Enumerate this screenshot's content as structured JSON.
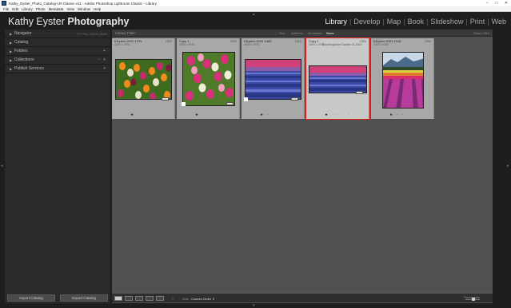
{
  "window": {
    "title": "Kathy_Eyster_Photo_Catalog-LR-Classic-v11 - Adobe Photoshop Lightroom Classic - Library",
    "minimize": "–",
    "maximize": "□",
    "close": "✕"
  },
  "menu": [
    "File",
    "Edit",
    "Library",
    "Photo",
    "Metadata",
    "View",
    "Window",
    "Help"
  ],
  "identity_plate": {
    "name": "Kathy Eyster",
    "studio": "Photography"
  },
  "modules": [
    {
      "label": "Library",
      "active": true
    },
    {
      "label": "Develop",
      "active": false
    },
    {
      "label": "Map",
      "active": false
    },
    {
      "label": "Book",
      "active": false
    },
    {
      "label": "Slideshow",
      "active": false
    },
    {
      "label": "Print",
      "active": false
    },
    {
      "label": "Web",
      "active": false
    }
  ],
  "left_panel": {
    "navigator": {
      "label": "Navigator",
      "extras": "FIT  FILL  100%  200%"
    },
    "catalog": {
      "label": "Catalog"
    },
    "folders": {
      "label": "Folders",
      "plus": "+"
    },
    "collections": {
      "label": "Collections",
      "minus": "−",
      "plus": "+"
    },
    "publish": {
      "label": "Publish Services",
      "plus": "+"
    },
    "import_button": "Import Catalog",
    "export_button": "Export Catalog"
  },
  "filter_bar": {
    "title": "Library Filter :",
    "options": [
      {
        "label": "Text",
        "active": false
      },
      {
        "label": "Attribute",
        "active": false
      },
      {
        "label": "Metadata",
        "active": false
      },
      {
        "label": "None",
        "active": true
      }
    ],
    "filters_off": "Filters Off ▾"
  },
  "photos": [
    {
      "name": "KEyster-2022-1376",
      "num": "CR2",
      "dims": "4000 x 2976",
      "garden": "Roozengaarde Garden 04-2022",
      "stars": "★ · · · ·",
      "image": "tulips-mixed",
      "selected": false
    },
    {
      "name": "Copy 1",
      "num": "CR2",
      "dims": "4000 x 2976",
      "garden": "Roozengaarde Garden 04-2022",
      "stars": "★ · · · ·",
      "image": "tulips-pink",
      "selected": false
    },
    {
      "name": "KEyster-2022-1465",
      "num": "CR2",
      "dims": "4000 x 2976",
      "garden": "Roozengaarde Garden 04-2022",
      "stars": "★ · · · ·",
      "image": "hyacinth-field",
      "selected": false
    },
    {
      "name": "Copy 1",
      "num": "CR2",
      "dims": "4000 x 2976",
      "garden": "Roozengaarde Garden 04-2022",
      "stars": "★ · · · ·",
      "image": "hyacinth-crop",
      "selected": true
    },
    {
      "name": "KEyster-2022-1918",
      "num": "CR2",
      "dims": "2976 x 4000",
      "garden": "Roozengaarde Garden 04-2022",
      "stars": "★ · · · ·",
      "image": "tulip-field-mountain",
      "selected": false
    }
  ],
  "toolbar": {
    "sort_label": "Sort:",
    "sort_value": "Custom Order ⇕",
    "thumbnails_label": "Thumbnails"
  },
  "colors": {
    "background": "#1e1e1e",
    "grid_bg": "#505050",
    "cell_bg": "#a8a8a8",
    "selection": "#e02020",
    "active_module": "#f1f1f1"
  }
}
